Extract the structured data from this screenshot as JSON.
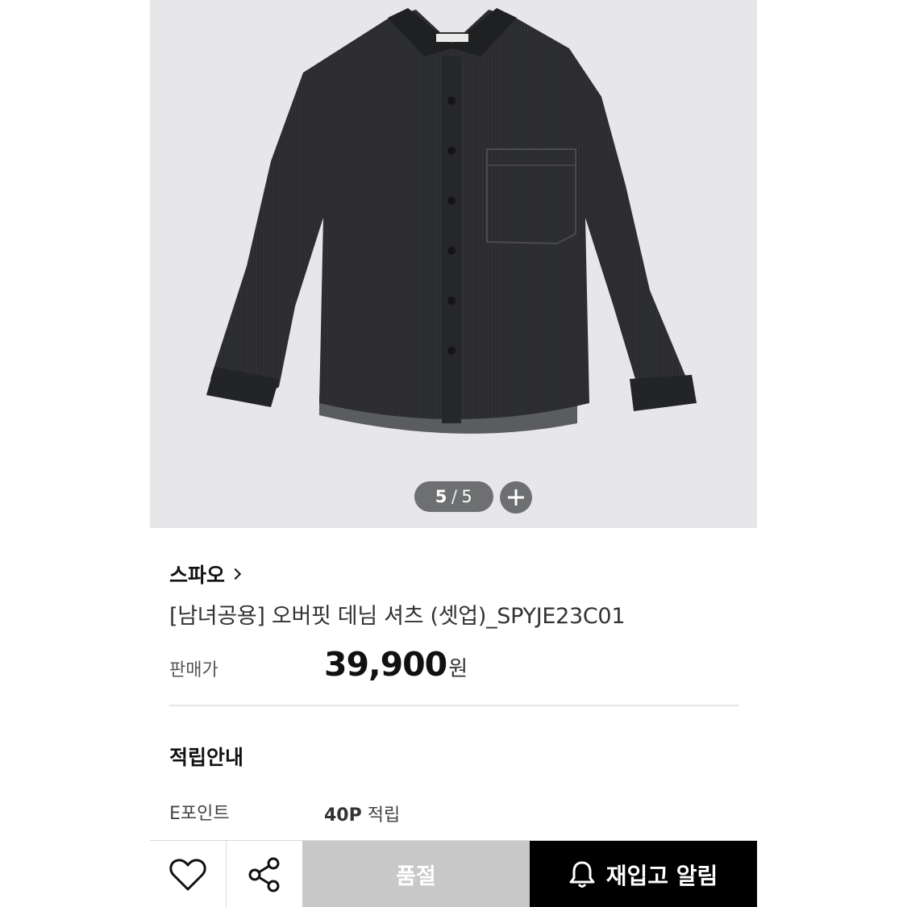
{
  "gallery": {
    "current": "5",
    "separator": "/",
    "total": "5",
    "image_alt_icon": "denim-shirt-image"
  },
  "product": {
    "brand": "스파오",
    "title": "[남녀공용] 오버핏 데님 셔츠 (셋업)_SPYJE23C01",
    "price_label": "판매가",
    "price": "39,900",
    "price_unit": "원"
  },
  "points": {
    "section_title": "적립안내",
    "label": "E포인트",
    "amount": "40P",
    "suffix": "적립"
  },
  "actions": {
    "wishlist_icon": "heart-icon",
    "share_icon": "share-icon",
    "soldout_label": "품절",
    "restock_label": "재입고 알림",
    "restock_icon": "bell-icon"
  },
  "colors": {
    "gallery_bg": "#e7e7e9",
    "soldout_bg": "#c8c8c8",
    "restock_bg": "#000000",
    "pager_bg": "#6e6f71"
  }
}
